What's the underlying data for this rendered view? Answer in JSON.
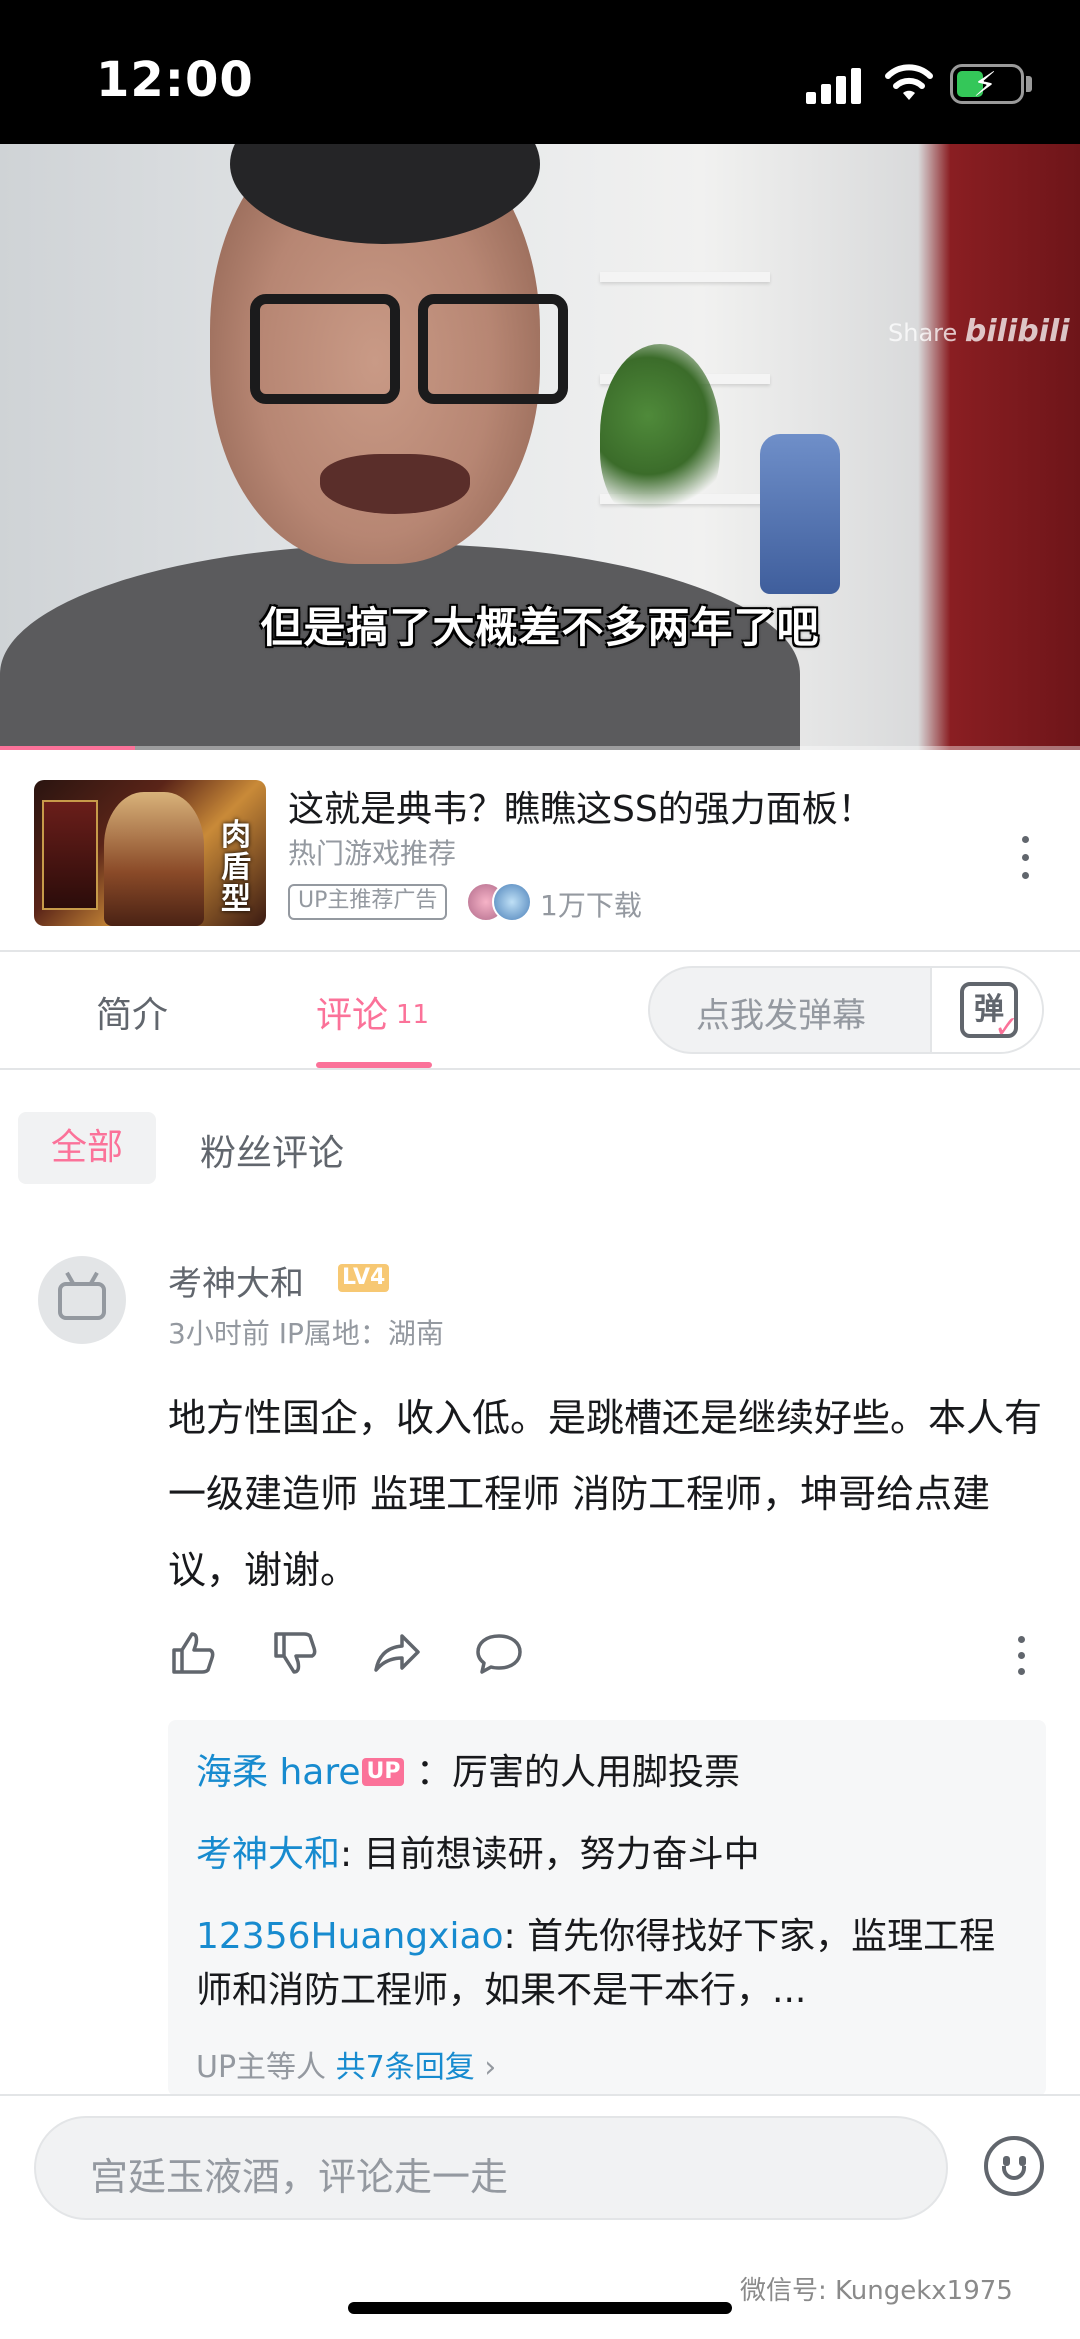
{
  "status_bar": {
    "time": "12:00",
    "signal_icon": "cellular-signal-icon",
    "wifi_icon": "wifi-icon",
    "battery_icon": "battery-charging-icon"
  },
  "video": {
    "subtitle": "但是搞了大概差不多两年了吧",
    "watermark_share": "Share",
    "watermark_brand": "bilibili",
    "progress": 0.125
  },
  "ad": {
    "thumb_tag": "肉盾型",
    "title": "这就是典韦？瞧瞧这SS的强力面板！",
    "subtitle": "热门游戏推荐",
    "badge": "UP主推荐广告",
    "downloads": "1万下载",
    "more_icon": "more-vertical-icon"
  },
  "tabs": {
    "intro": "简介",
    "comments": "评论",
    "comments_count": "11",
    "danmaku_placeholder": "点我发弹幕",
    "danmaku_icon_text": "弹"
  },
  "filters": {
    "all": "全部",
    "fans": "粉丝评论"
  },
  "comment": {
    "user": "考神大和",
    "level": "LV4",
    "time": "3小时前",
    "ip": "IP属地：湖南",
    "text": "地方性国企，收入低。是跳槽还是继续好些。本人有一级建造师 监理工程师 消防工程师，坤哥给点建议，谢谢。",
    "actions": [
      "like-icon",
      "dislike-icon",
      "share-icon",
      "reply-icon"
    ]
  },
  "replies": {
    "items": [
      {
        "name": "海柔 hare",
        "badge": "UP",
        "text": "：厉害的人用脚投票"
      },
      {
        "name": "考神大和",
        "badge": "",
        "text": ": 目前想读研，努力奋斗中"
      },
      {
        "name": "12356Huangxiao",
        "badge": "",
        "text": ": 首先你得找好下家，监理工程师和消防工程师，如果不是干本行，..."
      }
    ],
    "more_prefix": "UP主等人",
    "more_total": "共7条回复",
    "more_arrow": "›"
  },
  "bottom": {
    "placeholder": "宫廷玉液酒，评论走一走",
    "emoji_icon": "emoji-icon"
  },
  "watermark": "微信号: Kungekx1975"
}
